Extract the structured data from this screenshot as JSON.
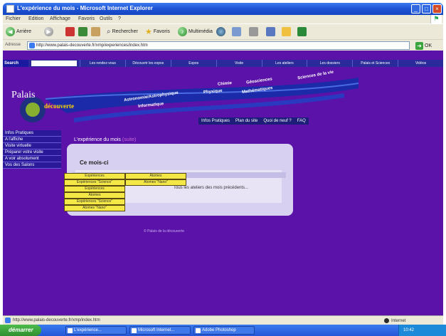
{
  "window": {
    "title": "L'expérience du mois - Microsoft Internet Explorer",
    "controls": [
      "_",
      "□",
      "×"
    ]
  },
  "menubar": {
    "items": [
      "Fichier",
      "Edition",
      "Affichage",
      "Favoris",
      "Outils",
      "?"
    ]
  },
  "toolbar": {
    "back": "Arrière",
    "forward": "",
    "search": "Rechercher",
    "favorites": "Favoris",
    "media": "Multimédia"
  },
  "address": {
    "label": "Adresse",
    "url": "http://www.palais-decouverte.fr/xmp/experiences/index.htm",
    "go": "OK"
  },
  "site_nav": {
    "search_label": "Search",
    "items": [
      "Les rendez-vous",
      "Découvrir les expos",
      "Expos",
      "Visite",
      "Les ateliers",
      "Les dossiers",
      "Palais et Sciences",
      "Vidéos"
    ]
  },
  "banner": {
    "logo_line1": "Palais",
    "logo_line2": "découverte",
    "links": [
      "Astronomie/Astrophysique",
      "Chimie",
      "Physique",
      "Géosciences",
      "Mathématiques",
      "Sciences de la vie",
      "Informatique"
    ]
  },
  "subnav": {
    "items": [
      "Infos Pratiques",
      "Plan du site",
      "Quoi de neuf ?",
      "FAQ"
    ]
  },
  "sidebar": {
    "items": [
      "Infos Pratiques",
      "A l'affiche",
      "Visite virtuelle",
      "Préparer votre visite",
      "A voir absolument",
      "Vos des Salons"
    ]
  },
  "main": {
    "title": "L'expérience du mois",
    "title_suffix": "(suite)",
    "panel_title": "Ce mois-ci",
    "panel_text": "Tous les ateliers des mois précédents..."
  },
  "yellow_menu": {
    "items": [
      "Expériences",
      "Atomes",
      "Expériences \"Science\"",
      "Atomes \"Nano\"",
      "Expériences",
      "Atomes",
      "Expériences \"Science\"",
      "Atomes \"Nano\""
    ]
  },
  "footer": {
    "text": "© Palais de la découverte"
  },
  "statusbar": {
    "text": "http://www.palais-decouverte.fr/xmp/index.htm",
    "zone": "Internet"
  },
  "taskbar": {
    "start": "démarrer",
    "tasks": [
      "L'expérience...",
      "Microsoft Internet...",
      "Adobe Photoshop"
    ],
    "clock": "10:42"
  },
  "colors": {
    "page_bg": "#5a12a8",
    "nav_bg": "#2a2a9a",
    "menu_yellow": "#f4e846",
    "panel_bg": "#d8d0f0"
  }
}
